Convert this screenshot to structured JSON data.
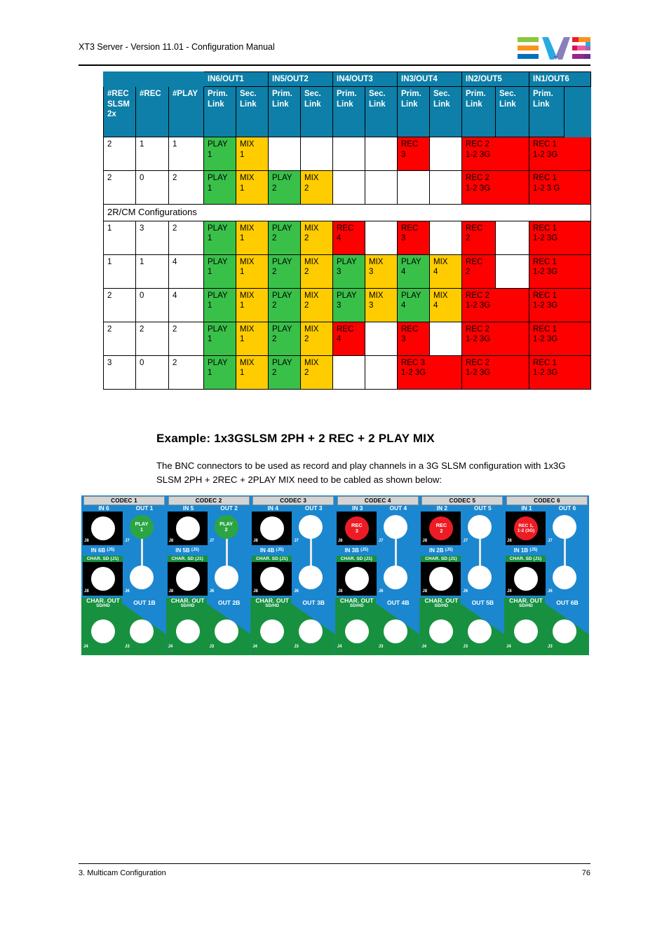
{
  "header": {
    "title": "XT3 Server - Version 11.01 - Configuration Manual",
    "logo_name": "evs-logo"
  },
  "footer": {
    "left": "3. Multicam Configuration",
    "page_number": "76"
  },
  "example": {
    "heading": "Example: 1x3GSLSM 2PH + 2 REC + 2 PLAY MIX",
    "paragraph": "The BNC connectors to be used as record and play channels in a 3G SLSM configuration with 1x3G SLSM 2PH + 2REC + 2PLAY MIX need to be cabled as shown below:"
  },
  "colors": {
    "header_blue": "#0d7fa8",
    "play_green": "#39c049",
    "mix_yellow": "#ffcc00",
    "rec_red": "#fe0000",
    "panel_blue": "#1b87d0",
    "panel_green": "#17913f",
    "bnc_rec": "#ed1c24",
    "bnc_play": "#2ba544"
  },
  "table": {
    "group_headers": [
      "",
      "",
      "",
      "IN6/OUT1",
      "IN5/OUT2",
      "IN4/OUT3",
      "IN3/OUT4",
      "IN2/OUT5",
      "IN1/OUT6"
    ],
    "col_headers": [
      "#REC SLSM 2x",
      "#REC",
      "#PLAY",
      "Prim. Link",
      "Sec. Link",
      "Prim. Link",
      "Sec. Link",
      "Prim. Link",
      "Sec. Link",
      "Prim. Link",
      "Sec. Link",
      "Prim. Link",
      "Sec. Link",
      "Prim. Link",
      ""
    ],
    "col_headers_short": {
      "c1": "#REC SLSM 2x",
      "c2": "#REC",
      "c3": "#PLAY",
      "prim": "Prim. Link",
      "sec": "Sec. Link",
      "blank": ""
    },
    "section_label": "2R/CM Configurations",
    "rows": [
      {
        "rec_slsm_2x": "2",
        "rec": "1",
        "play": "1",
        "cells": [
          {
            "l1": "PLAY",
            "l2": "1",
            "type": "play"
          },
          {
            "l1": "MIX",
            "l2": "1",
            "type": "mix"
          },
          {
            "l1": "",
            "l2": "",
            "type": "none"
          },
          {
            "l1": "",
            "l2": "",
            "type": "none"
          },
          {
            "l1": "",
            "l2": "",
            "type": "none"
          },
          {
            "l1": "",
            "l2": "",
            "type": "none"
          },
          {
            "l1": "REC",
            "l2": "3",
            "type": "rec"
          },
          {
            "l1": "",
            "l2": "",
            "type": "none"
          },
          {
            "l1": "REC 2",
            "l2": "1-2 3G",
            "type": "rec",
            "span": 2
          },
          {
            "l1": "REC 1",
            "l2": "1-2 3G",
            "type": "rec",
            "span": 2
          }
        ]
      },
      {
        "rec_slsm_2x": "2",
        "rec": "0",
        "play": "2",
        "cells": [
          {
            "l1": "PLAY",
            "l2": "1",
            "type": "play"
          },
          {
            "l1": "MIX",
            "l2": "1",
            "type": "mix"
          },
          {
            "l1": "PLAY",
            "l2": "2",
            "type": "play"
          },
          {
            "l1": "MIX",
            "l2": "2",
            "type": "mix"
          },
          {
            "l1": "",
            "l2": "",
            "type": "none"
          },
          {
            "l1": "",
            "l2": "",
            "type": "none"
          },
          {
            "l1": "",
            "l2": "",
            "type": "none"
          },
          {
            "l1": "",
            "l2": "",
            "type": "none"
          },
          {
            "l1": "REC 2",
            "l2": "1-2 3G",
            "type": "rec",
            "span": 2
          },
          {
            "l1": "REC 1",
            "l2": "1-2 3 G",
            "type": "rec",
            "span": 2
          }
        ]
      },
      {
        "rec_slsm_2x": "1",
        "rec": "3",
        "play": "2",
        "cells": [
          {
            "l1": "PLAY",
            "l2": "1",
            "type": "play"
          },
          {
            "l1": "MIX",
            "l2": "1",
            "type": "mix"
          },
          {
            "l1": "PLAY",
            "l2": "2",
            "type": "play"
          },
          {
            "l1": "MIX",
            "l2": "2",
            "type": "mix"
          },
          {
            "l1": "REC",
            "l2": "4",
            "type": "rec"
          },
          {
            "l1": "",
            "l2": "",
            "type": "none"
          },
          {
            "l1": "REC",
            "l2": "3",
            "type": "rec"
          },
          {
            "l1": "",
            "l2": "",
            "type": "none"
          },
          {
            "l1": "REC",
            "l2": "2",
            "type": "rec"
          },
          {
            "l1": "",
            "l2": "",
            "type": "none"
          },
          {
            "l1": "REC 1",
            "l2": "1-2 3G",
            "type": "rec",
            "span": 2
          }
        ]
      },
      {
        "rec_slsm_2x": "1",
        "rec": "1",
        "play": "4",
        "cells": [
          {
            "l1": "PLAY",
            "l2": "1",
            "type": "play"
          },
          {
            "l1": "MIX",
            "l2": "1",
            "type": "mix"
          },
          {
            "l1": "PLAY",
            "l2": "2",
            "type": "play"
          },
          {
            "l1": "MIX",
            "l2": "2",
            "type": "mix"
          },
          {
            "l1": "PLAY",
            "l2": "3",
            "type": "play"
          },
          {
            "l1": "MIX",
            "l2": "3",
            "type": "mix"
          },
          {
            "l1": "PLAY",
            "l2": "4",
            "type": "play"
          },
          {
            "l1": "MIX",
            "l2": "4",
            "type": "mix"
          },
          {
            "l1": "REC",
            "l2": "2",
            "type": "rec"
          },
          {
            "l1": "",
            "l2": "",
            "type": "none"
          },
          {
            "l1": "REC 1",
            "l2": "1-2 3G",
            "type": "rec",
            "span": 2
          }
        ]
      },
      {
        "rec_slsm_2x": "2",
        "rec": "0",
        "play": "4",
        "cells": [
          {
            "l1": "PLAY",
            "l2": "1",
            "type": "play"
          },
          {
            "l1": "MIX",
            "l2": "1",
            "type": "mix"
          },
          {
            "l1": "PLAY",
            "l2": "2",
            "type": "play"
          },
          {
            "l1": "MIX",
            "l2": "2",
            "type": "mix"
          },
          {
            "l1": "PLAY",
            "l2": "3",
            "type": "play"
          },
          {
            "l1": "MIX",
            "l2": "3",
            "type": "mix"
          },
          {
            "l1": "PLAY",
            "l2": "4",
            "type": "play"
          },
          {
            "l1": "MIX",
            "l2": "4",
            "type": "mix"
          },
          {
            "l1": "REC 2",
            "l2": "1-2 3G",
            "type": "rec",
            "span": 2
          },
          {
            "l1": "REC 1",
            "l2": "1-2 3G",
            "type": "rec",
            "span": 2
          }
        ]
      },
      {
        "rec_slsm_2x": "2",
        "rec": "2",
        "play": "2",
        "cells": [
          {
            "l1": "PLAY",
            "l2": "1",
            "type": "play"
          },
          {
            "l1": "MIX",
            "l2": "1",
            "type": "mix"
          },
          {
            "l1": "PLAY",
            "l2": "2",
            "type": "play"
          },
          {
            "l1": "MIX",
            "l2": "2",
            "type": "mix"
          },
          {
            "l1": "REC",
            "l2": "4",
            "type": "rec"
          },
          {
            "l1": "",
            "l2": "",
            "type": "none"
          },
          {
            "l1": "REC",
            "l2": "3",
            "type": "rec"
          },
          {
            "l1": "",
            "l2": "",
            "type": "none"
          },
          {
            "l1": "REC 2",
            "l2": "1-2 3G",
            "type": "rec",
            "span": 2
          },
          {
            "l1": "REC 1",
            "l2": "1-2 3G",
            "type": "rec",
            "span": 2
          }
        ]
      },
      {
        "rec_slsm_2x": "3",
        "rec": "0",
        "play": "2",
        "cells": [
          {
            "l1": "PLAY",
            "l2": "1",
            "type": "play"
          },
          {
            "l1": "MIX",
            "l2": "1",
            "type": "mix"
          },
          {
            "l1": "PLAY",
            "l2": "2",
            "type": "play"
          },
          {
            "l1": "MIX",
            "l2": "2",
            "type": "mix"
          },
          {
            "l1": "",
            "l2": "",
            "type": "none"
          },
          {
            "l1": "",
            "l2": "",
            "type": "none"
          },
          {
            "l1": "REC 3",
            "l2": "1-2 3G",
            "type": "rec",
            "span": 2
          },
          {
            "l1": "REC 2",
            "l2": "1-2 3G",
            "type": "rec",
            "span": 2
          },
          {
            "l1": "REC 1",
            "l2": "1-2 3G",
            "type": "rec",
            "span": 2
          }
        ]
      }
    ]
  },
  "panel": {
    "codecs": [
      {
        "codec_label": "CODEC 1",
        "in_label": "IN 6",
        "out_label": "OUT 1",
        "inb_label": "IN 6B",
        "inb_sub": "(J5)",
        "charsd_label": "CHAR. SD (J1)",
        "charout_label": "CHAR. OUT",
        "charout_sub": "SD/HD",
        "outb_label": "OUT 1B",
        "j_in_top": "J8",
        "j_out_top": "J7",
        "j_in_bot": "J8",
        "j_out_bot": "J6",
        "j_base_left": "J4",
        "j_base_right": "J3",
        "in_bnc_state": "idle",
        "in_bnc_text": "",
        "out_bnc_state": "play",
        "out_bnc_l1": "PLAY",
        "out_bnc_l2": "1",
        "cable": true
      },
      {
        "codec_label": "CODEC 2",
        "in_label": "IN 5",
        "out_label": "OUT 2",
        "inb_label": "IN 5B",
        "inb_sub": "(J5)",
        "charsd_label": "CHAR. SD (J1)",
        "charout_label": "CHAR. OUT",
        "charout_sub": "SD/HD",
        "outb_label": "OUT 2B",
        "j_in_top": "J8",
        "j_out_top": "J7",
        "j_in_bot": "J8",
        "j_out_bot": "J6",
        "j_base_left": "J4",
        "j_base_right": "J3",
        "in_bnc_state": "idle",
        "in_bnc_text": "",
        "out_bnc_state": "play",
        "out_bnc_l1": "PLAY",
        "out_bnc_l2": "2",
        "cable": true
      },
      {
        "codec_label": "CODEC 3",
        "in_label": "IN 4",
        "out_label": "OUT 3",
        "inb_label": "IN 4B",
        "inb_sub": "(J5)",
        "charsd_label": "CHAR. SD (J1)",
        "charout_label": "CHAR. OUT",
        "charout_sub": "SD/HD",
        "outb_label": "OUT 3B",
        "j_in_top": "J8",
        "j_out_top": "J7",
        "j_in_bot": "J8",
        "j_out_bot": "J6",
        "j_base_left": "J4",
        "j_base_right": "J3",
        "in_bnc_state": "idle",
        "in_bnc_text": "",
        "out_bnc_state": "idle",
        "out_bnc_l1": "",
        "out_bnc_l2": "",
        "cable": true
      },
      {
        "codec_label": "CODEC 4",
        "in_label": "IN 3",
        "out_label": "OUT 4",
        "inb_label": "IN 3B",
        "inb_sub": "(J5)",
        "charsd_label": "CHAR. SD (J1)",
        "charout_label": "CHAR. OUT",
        "charout_sub": "SD/HD",
        "outb_label": "OUT 4B",
        "j_in_top": "J8",
        "j_out_top": "J7",
        "j_in_bot": "J8",
        "j_out_bot": "J6",
        "j_base_left": "J4",
        "j_base_right": "J3",
        "in_bnc_state": "rec",
        "in_bnc_l1": "REC",
        "in_bnc_l2": "3",
        "out_bnc_state": "idle",
        "out_bnc_l1": "",
        "out_bnc_l2": "",
        "cable": true
      },
      {
        "codec_label": "CODEC 5",
        "in_label": "IN 2",
        "out_label": "OUT 5",
        "inb_label": "IN 2B",
        "inb_sub": "(J5)",
        "charsd_label": "CHAR. SD (J1)",
        "charout_label": "CHAR. OUT",
        "charout_sub": "SD/HD",
        "outb_label": "OUT 5B",
        "j_in_top": "J8",
        "j_out_top": "J7",
        "j_in_bot": "J8",
        "j_out_bot": "J6",
        "j_base_left": "J4",
        "j_base_right": "J3",
        "in_bnc_state": "rec",
        "in_bnc_l1": "REC",
        "in_bnc_l2": "2",
        "out_bnc_state": "idle",
        "out_bnc_l1": "",
        "out_bnc_l2": "",
        "cable": true
      },
      {
        "codec_label": "CODEC 6",
        "in_label": "IN 1",
        "out_label": "OUT 6",
        "inb_label": "IN 1B",
        "inb_sub": "(J5)",
        "charsd_label": "CHAR. SD (J1)",
        "charout_label": "CHAR. OUT",
        "charout_sub": "SD/HD",
        "outb_label": "OUT 6B",
        "j_in_top": "J8",
        "j_out_top": "J7",
        "j_in_bot": "J8",
        "j_out_bot": "J6",
        "j_base_left": "J4",
        "j_base_right": "J3",
        "in_bnc_state": "rec",
        "in_bnc_l1": "REC 1,",
        "in_bnc_l2": "1-2 (3G)",
        "out_bnc_state": "idle",
        "out_bnc_l1": "",
        "out_bnc_l2": "",
        "cable": true
      }
    ]
  }
}
